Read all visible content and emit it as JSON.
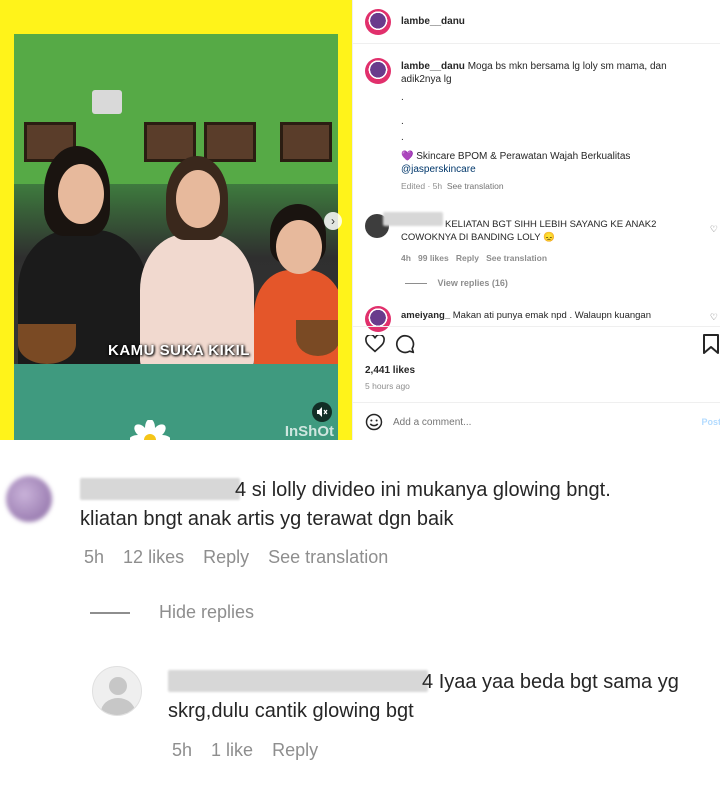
{
  "post": {
    "username": "lambe__danu",
    "caption_user": "lambe__danu",
    "caption_text": "Moga bs mkn bersama lg loly sm mama, dan adik2nya lg",
    "caption_dots": [
      ".",
      ".",
      "."
    ],
    "promo_text": "Skincare BPOM & Perawatan Wajah Berkualitas",
    "promo_heart": "💜",
    "promo_handle": "@jasperskincare",
    "edited_time": "Edited · 5h",
    "see_translation": "See translation",
    "video_caption": "KAMU SUKA KIKIL",
    "video_watermark": "InShOt",
    "comment1": {
      "text": "KELIATAN BGT SIHH LEBIH SAYANG KE ANAK2 COWOKNYA DI BANDING LOLY 😞",
      "time": "4h",
      "likes": "99 likes",
      "reply": "Reply",
      "translation": "See translation"
    },
    "view_replies": "View replies (16)",
    "comment2": {
      "username": "ameiyang_",
      "text": "Makan ati punya emak npd . Walaupn kuangan"
    },
    "likes": "2,441 likes",
    "posted": "5 hours ago",
    "add_comment_placeholder": "Add a comment...",
    "post_button": "Post"
  },
  "zoom": {
    "comment": {
      "mention_fragment": "4",
      "text_line1": "si lolly divideo ini mukanya glowing bngt.",
      "text_line2": "kliatan bngt anak artis yg terawat dgn baik",
      "time": "5h",
      "likes": "12 likes",
      "reply": "Reply",
      "translation": "See translation"
    },
    "hide_replies": "Hide replies",
    "reply": {
      "mention_fragment": "4",
      "text_line1": "Iyaa yaa beda bgt sama yg",
      "text_line2": "skrg,dulu cantik glowing bgt",
      "time": "5h",
      "likes": "1 like",
      "reply": "Reply"
    }
  },
  "icons": [
    "heart-icon",
    "comment-icon",
    "bookmark-icon",
    "emoji-icon",
    "sound-off-icon",
    "chevron-right-icon"
  ],
  "colors": {
    "frame_yellow": "#fff31a",
    "link_blue": "#00376b",
    "muted_gray": "#8e8e8e"
  }
}
